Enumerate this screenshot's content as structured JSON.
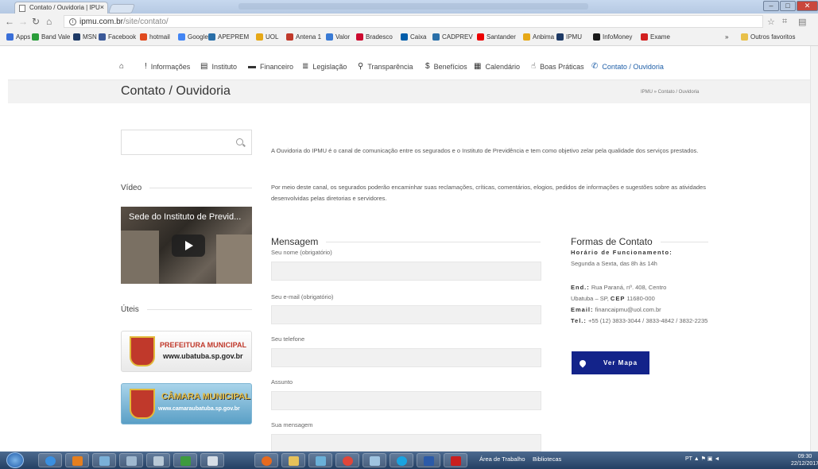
{
  "browser": {
    "tab_title": "Contato / Ouvidoria | IPU",
    "tab_close": "×",
    "url_domain": "ipmu.com.br",
    "url_path": "/site/contato/",
    "bookmarks": [
      {
        "label": "Apps",
        "color": "#3a6fd8"
      },
      {
        "label": "Band Vale",
        "color": "#2a9d3a"
      },
      {
        "label": "MSN",
        "color": "#1e3a66"
      },
      {
        "label": "Facebook",
        "color": "#3b5998"
      },
      {
        "label": "hotmail",
        "color": "#e04a1f"
      },
      {
        "label": "Google",
        "color": "#4285f4"
      },
      {
        "label": "APEPREM",
        "color": "#2a6fa8"
      },
      {
        "label": "UOL",
        "color": "#e6a817"
      },
      {
        "label": "Antena 1",
        "color": "#c0392b"
      },
      {
        "label": "Valor",
        "color": "#3a7bd5"
      },
      {
        "label": "Bradesco",
        "color": "#cc092f"
      },
      {
        "label": "Caixa",
        "color": "#005ca9"
      },
      {
        "label": "CADPREV",
        "color": "#2a6fa8"
      },
      {
        "label": "Santander",
        "color": "#ec0000"
      },
      {
        "label": "Anbima",
        "color": "#e6a817"
      },
      {
        "label": "IPMU",
        "color": "#1e3a66"
      },
      {
        "label": "InfoMoney",
        "color": "#1a1a1a"
      },
      {
        "label": "Exame",
        "color": "#d21f1f"
      }
    ],
    "more_bookmarks": "»",
    "other_bookmarks": "Outros favoritos"
  },
  "site_nav": {
    "items": [
      {
        "label": "",
        "icon": "home-icon",
        "glyph": "⌂"
      },
      {
        "label": "Informações",
        "icon": "info-icon",
        "glyph": "!"
      },
      {
        "label": "Instituto",
        "icon": "building-icon",
        "glyph": "▤"
      },
      {
        "label": "Financeiro",
        "icon": "money-icon",
        "glyph": "▬"
      },
      {
        "label": "Legislação",
        "icon": "list-icon",
        "glyph": "≣"
      },
      {
        "label": "Transparência",
        "icon": "search-icon",
        "glyph": "⚲"
      },
      {
        "label": "Benefícios",
        "icon": "dollar-icon",
        "glyph": "$"
      },
      {
        "label": "Calendário",
        "icon": "calendar-icon",
        "glyph": "▦"
      },
      {
        "label": "Boas Práticas",
        "icon": "thumbs-up-icon",
        "glyph": "☝"
      },
      {
        "label": "Contato / Ouvidoria",
        "icon": "phone-icon",
        "glyph": "✆",
        "active": true
      }
    ]
  },
  "page": {
    "title": "Contato / Ouvidoria",
    "breadcrumb": "IPMU » Contato / Ouvidoria"
  },
  "sidebar": {
    "video_heading": "Vídeo",
    "video_title": "Sede do Instituto de Previd...",
    "uteis_heading": "Úteis",
    "banner_pref_line1": "PREFEITURA MUNICIPAL",
    "banner_pref_line2": "www.ubatuba.sp.gov.br",
    "banner_cam_line1": "CÂMARA MUNICIPAL",
    "banner_cam_line2": "www.camaraubatuba.sp.gov.br"
  },
  "intro": {
    "p1": "A Ouvidoria do IPMU é o canal de comunicação entre os segurados e o Instituto de Previdência e tem como objetivo zelar pela qualidade dos serviços prestados.",
    "p2": "Por meio deste canal, os segurados poderão encaminhar suas reclamações, críticas, comentários, elogios, pedidos de informações e sugestões sobre as atividades desenvolvidas pelas diretorias e servidores."
  },
  "form": {
    "heading": "Mensagem",
    "name_label": "Seu nome (obrigatório)",
    "email_label": "Seu e-mail (obrigatório)",
    "phone_label": "Seu telefone",
    "subject_label": "Assunto",
    "message_label": "Sua mensagem"
  },
  "contact": {
    "heading": "Formas de Contato",
    "hours_label": "Horário de Funcionamento:",
    "hours_value": "Segunda a Sexta, das 8h às 14h",
    "addr_label": "End.:",
    "addr_value": "Rua Paraná, nº. 408, Centro",
    "city_value": "Ubatuba – SP,",
    "cep_label": "CEP",
    "cep_value": "11680-000",
    "email_label": "Email:",
    "email_value": "financaipmu@uol.com.br",
    "tel_label": "Tel.:",
    "tel_value": "+55 (12) 3833-3044 / 3833-4842 / 3832-2235",
    "map_button": "Ver Mapa"
  },
  "taskbar": {
    "desktop_label": "Área de Trabalho",
    "libraries_label": "Bibliotecas",
    "lang": "PT",
    "time": "09:30",
    "date": "22/12/2017"
  }
}
